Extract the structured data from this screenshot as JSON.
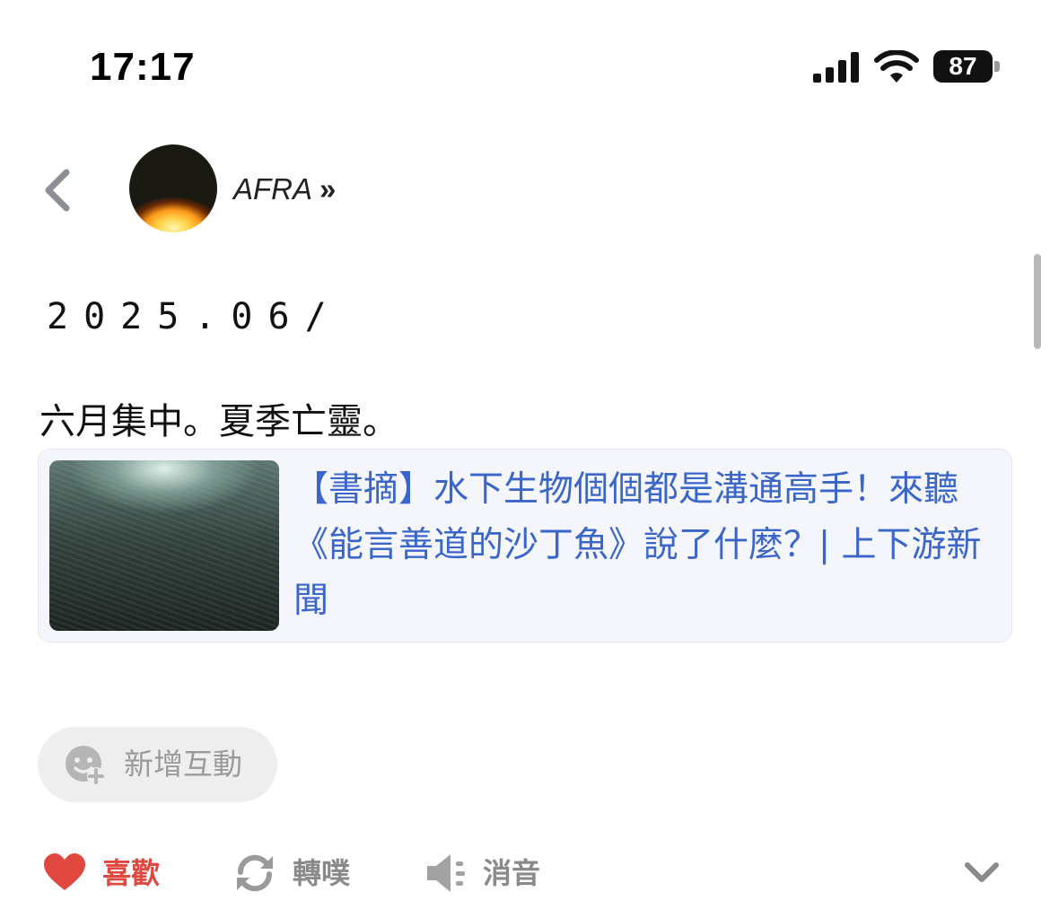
{
  "status_bar": {
    "time": "17:17",
    "battery": "87"
  },
  "header": {
    "author": "AFRA",
    "author_arrow": "»"
  },
  "post": {
    "date": "2025.06/",
    "text": "六月集中。夏季亡靈。",
    "link_card": {
      "title": "【書摘】水下生物個個都是溝通高手！來聽《能言善道的沙丁魚》說了什麼？| 上下游新聞"
    }
  },
  "interaction": {
    "add_label": "新增互動"
  },
  "actions": {
    "like": "喜歡",
    "repost": "轉噗",
    "mute": "消音"
  },
  "colors": {
    "accent_like": "#e0483f",
    "link": "#3b66c9",
    "muted": "#8a8a8a"
  }
}
